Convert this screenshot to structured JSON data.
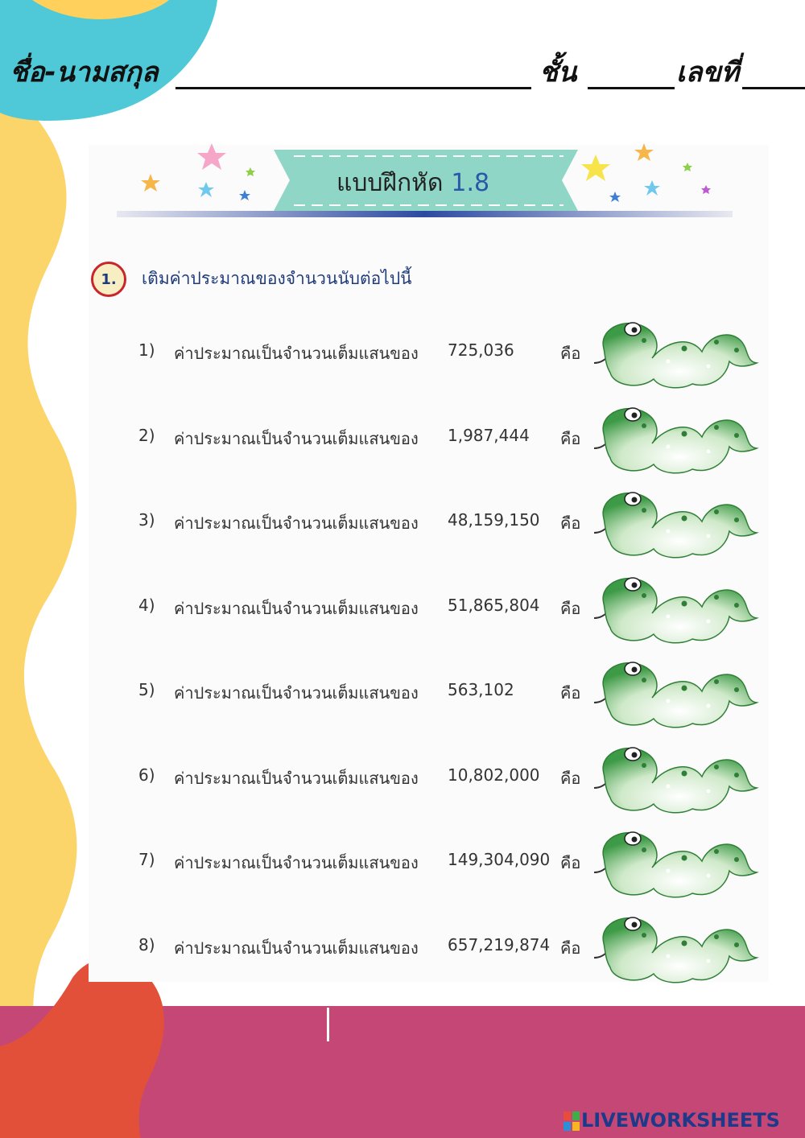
{
  "header": {
    "name_label": "ชื่อ-นามสกุล",
    "class_label": "ชั้น",
    "number_label": "เลขที่"
  },
  "exercise": {
    "title": "แบบฝึกหัด",
    "number": "1.8"
  },
  "question": {
    "number": "1.",
    "instruction": "เติมค่าประมาณของจำนวนนับต่อไปนี้"
  },
  "items": [
    {
      "no": "1)",
      "text": "ค่าประมาณเป็นจำนวนเต็มแสนของ",
      "value": "725,036",
      "is": "คือ"
    },
    {
      "no": "2)",
      "text": "ค่าประมาณเป็นจำนวนเต็มแสนของ",
      "value": "1,987,444",
      "is": "คือ"
    },
    {
      "no": "3)",
      "text": "ค่าประมาณเป็นจำนวนเต็มแสนของ",
      "value": "48,159,150",
      "is": "คือ"
    },
    {
      "no": "4)",
      "text": "ค่าประมาณเป็นจำนวนเต็มแสนของ",
      "value": "51,865,804",
      "is": "คือ"
    },
    {
      "no": "5)",
      "text": "ค่าประมาณเป็นจำนวนเต็มแสนของ",
      "value": "563,102",
      "is": "คือ"
    },
    {
      "no": "6)",
      "text": "ค่าประมาณเป็นจำนวนเต็มแสนของ",
      "value": "10,802,000",
      "is": "คือ"
    },
    {
      "no": "7)",
      "text": "ค่าประมาณเป็นจำนวนเต็มแสนของ",
      "value": "149,304,090",
      "is": "คือ"
    },
    {
      "no": "8)",
      "text": "ค่าประมาณเป็นจำนวนเต็มแสนของ",
      "value": "657,219,874",
      "is": "คือ"
    }
  ],
  "footer": {
    "brand": "LIVEWORKSHEETS"
  },
  "colors": {
    "cyan_blob": "#4fc9d8",
    "yellow_band": "#fbd46a",
    "orange_blob": "#e2503a",
    "pink_band": "#c94b79",
    "snake_green": "#3d9a46",
    "banner": "#8fd6c7"
  }
}
